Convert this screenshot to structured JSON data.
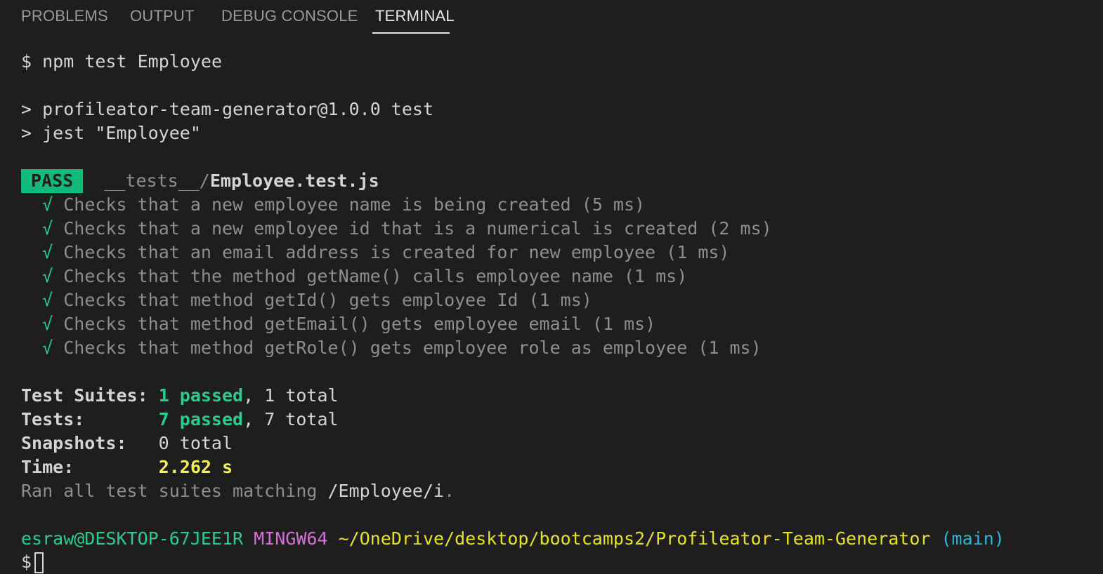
{
  "panel": {
    "tabs": [
      {
        "label": "PROBLEMS"
      },
      {
        "label": "OUTPUT"
      },
      {
        "label": "DEBUG CONSOLE"
      },
      {
        "label": "TERMINAL"
      }
    ],
    "active_tab": "TERMINAL"
  },
  "terminal": {
    "prompt_symbol": "$",
    "command": "npm test Employee",
    "script_lines": [
      "> profileator-team-generator@1.0.0 test",
      "> jest \"Employee\""
    ],
    "result": {
      "status": "PASS",
      "path_dir": "__tests__/",
      "path_file": "Employee.test.js"
    },
    "check_mark": "√",
    "tests": [
      {
        "name": "Checks that a new employee name is being created",
        "time": "(5 ms)"
      },
      {
        "name": "Checks that a new employee id that is a numerical is created",
        "time": "(2 ms)"
      },
      {
        "name": "Checks that an email address is created for new employee",
        "time": "(1 ms)"
      },
      {
        "name": "Checks that the method getName() calls employee name",
        "time": "(1 ms)"
      },
      {
        "name": "Checks that method getId() gets employee Id",
        "time": "(1 ms)"
      },
      {
        "name": "Checks that method getEmail() gets employee email",
        "time": "(1 ms)"
      },
      {
        "name": "Checks that method getRole() gets employee role as employee",
        "time": "(1 ms)"
      }
    ],
    "summary": {
      "suites_label": "Test Suites:",
      "suites_passed": "1 passed",
      "suites_total": ", 1 total",
      "tests_label": "Tests:",
      "tests_passed": "7 passed",
      "tests_total": ", 7 total",
      "snapshots_label": "Snapshots:",
      "snapshots_value": "0 total",
      "time_label": "Time:",
      "time_value": "2.262 s",
      "ran_prefix": "Ran all test suites matching ",
      "ran_pattern": "/Employee/i",
      "ran_suffix": "."
    },
    "prompt": {
      "user_host": "esraw@DESKTOP-67JEE1R",
      "shell": "MINGW64",
      "cwd": "~/OneDrive/desktop/bootcamps2/Profileator-Team-Generator",
      "branch": "(main)"
    }
  },
  "colors": {
    "background": "#1e1e1e",
    "pass_badge": "#0dbc79",
    "green": "#23d18b",
    "yellow": "#f5f543",
    "magenta": "#d670d6",
    "cyan": "#29b8db"
  }
}
